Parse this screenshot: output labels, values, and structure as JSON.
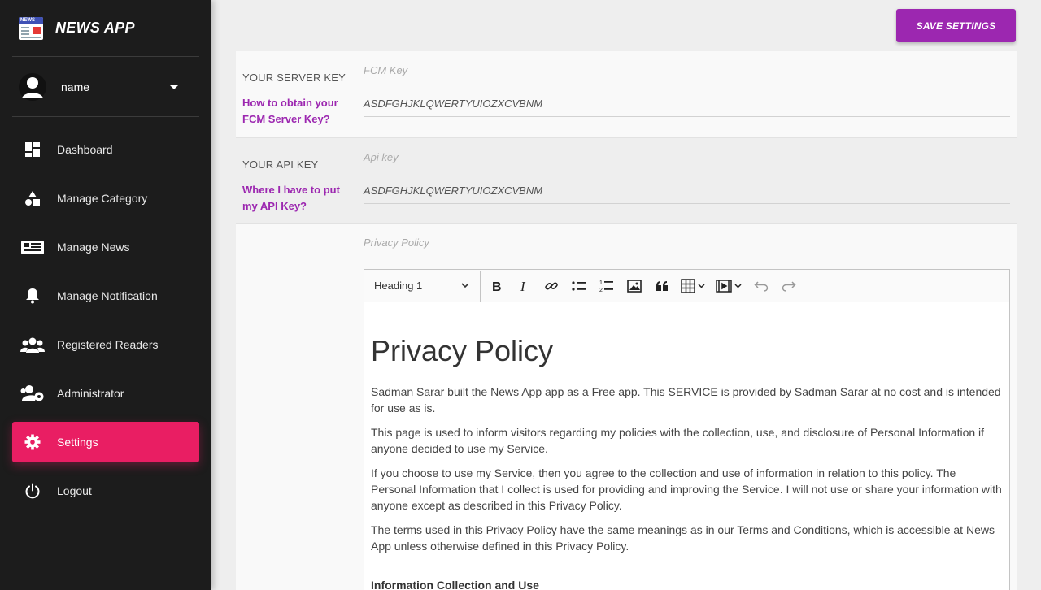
{
  "app": {
    "title": "NEWS APP",
    "logo_text": "NEWS"
  },
  "user": {
    "name": "name"
  },
  "nav": [
    {
      "label": "Dashboard",
      "icon": "dashboard-icon"
    },
    {
      "label": "Manage Category",
      "icon": "category-icon"
    },
    {
      "label": "Manage News",
      "icon": "news-icon"
    },
    {
      "label": "Manage Notification",
      "icon": "bell-icon"
    },
    {
      "label": "Registered Readers",
      "icon": "people-icon"
    },
    {
      "label": "Administrator",
      "icon": "admin-icon"
    },
    {
      "label": "Settings",
      "icon": "gear-icon",
      "active": true
    },
    {
      "label": "Logout",
      "icon": "power-icon"
    }
  ],
  "toolbar": {
    "save_label": "SAVE SETTINGS"
  },
  "server_key": {
    "label": "YOUR SERVER KEY",
    "help": "How to obtain your FCM Server Key?",
    "field_label": "FCM Key",
    "value": "ASDFGHJKLQWERTYUIOZXCVBNM"
  },
  "api_key": {
    "label": "YOUR API KEY",
    "help": "Where I have to put my API Key?",
    "field_label": "Api key",
    "value": "ASDFGHJKLQWERTYUIOZXCVBNM"
  },
  "privacy": {
    "field_label": "Privacy Policy",
    "heading_select": "Heading 1",
    "title": "Privacy Policy",
    "paragraphs": [
      "Sadman Sarar built the News App app as a Free app. This SERVICE is provided by Sadman Sarar at no cost and is intended for use as is.",
      "This page is used to inform visitors regarding my policies with the collection, use, and disclosure of Personal Information if anyone decided to use my Service.",
      "If you choose to use my Service, then you agree to the collection and use of information in relation to this policy. The Personal Information that I collect is used for providing and improving the Service. I will not use or share your information with anyone except as described in this Privacy Policy.",
      "The terms used in this Privacy Policy have the same meanings as in our Terms and Conditions, which is accessible at News App unless otherwise defined in this Privacy Policy."
    ],
    "subheading": "Information Collection and Use"
  },
  "colors": {
    "sidebar_bg": "#1c1c1c",
    "active": "#e91e63",
    "accent": "#9c27b0"
  }
}
